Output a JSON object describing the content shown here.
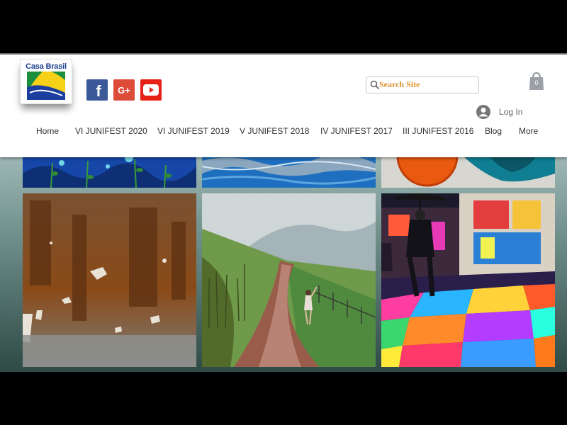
{
  "logo": {
    "text": "Casa Brasil"
  },
  "social": [
    {
      "name": "Facebook",
      "glyph": "f",
      "color": "#3b5998"
    },
    {
      "name": "Google+",
      "glyph": "G+",
      "color": "#dd4b39"
    },
    {
      "name": "YouTube",
      "glyph": "",
      "color": "#e62117"
    }
  ],
  "search": {
    "placeholder": "Search Site"
  },
  "cart": {
    "count": "0"
  },
  "login": {
    "label": "Log In"
  },
  "nav": {
    "items": [
      {
        "label": "Home"
      },
      {
        "label": "VI JUNIFEST 2020"
      },
      {
        "label": "VI JUNIFEST 2019"
      },
      {
        "label": "V JUNIFEST 2018"
      },
      {
        "label": "IV JUNIFEST 2017"
      },
      {
        "label": "III JUNIFEST 2016"
      },
      {
        "label": "Blog"
      },
      {
        "label": "More"
      }
    ]
  },
  "gallery": {
    "tiles": [
      {
        "name": "blue-floral-painting"
      },
      {
        "name": "blue-water-painting"
      },
      {
        "name": "orange-teal-painting"
      },
      {
        "name": "rust-texture-painting"
      },
      {
        "name": "rainy-road-painting"
      },
      {
        "name": "rainy-street-painting"
      }
    ]
  },
  "colors": {
    "accent_search_text": "#e0922e",
    "cart_icon": "#9aa0a5",
    "nav_text": "#333333"
  }
}
